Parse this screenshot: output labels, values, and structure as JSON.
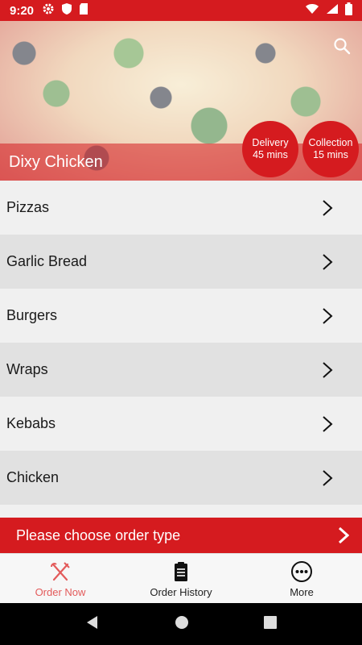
{
  "status_bar": {
    "time": "9:20",
    "icons_left": [
      "settings-icon",
      "shield-icon",
      "sd-card-icon"
    ],
    "icons_right": [
      "wifi-icon",
      "signal-icon",
      "battery-icon"
    ]
  },
  "hero": {
    "restaurant_name": "Dixy Chicken",
    "search_icon": "search-icon",
    "delivery": {
      "label": "Delivery",
      "time": "45 mins"
    },
    "collection": {
      "label": "Collection",
      "time": "15 mins"
    }
  },
  "menu": {
    "items": [
      {
        "label": "Pizzas"
      },
      {
        "label": "Garlic Bread"
      },
      {
        "label": "Burgers"
      },
      {
        "label": "Wraps"
      },
      {
        "label": "Kebabs"
      },
      {
        "label": "Chicken"
      }
    ]
  },
  "order_type_bar": {
    "label": "Please choose order type"
  },
  "bottom_nav": {
    "items": [
      {
        "label": "Order Now",
        "icon": "fork-knife-icon",
        "active": true
      },
      {
        "label": "Order History",
        "icon": "clipboard-icon",
        "active": false
      },
      {
        "label": "More",
        "icon": "more-dots-icon",
        "active": false
      }
    ]
  },
  "colors": {
    "brand_red": "#d51b1f",
    "active_nav": "#e35a5a",
    "row_light": "#f0f0f0",
    "row_dark": "#e1e1e1"
  }
}
